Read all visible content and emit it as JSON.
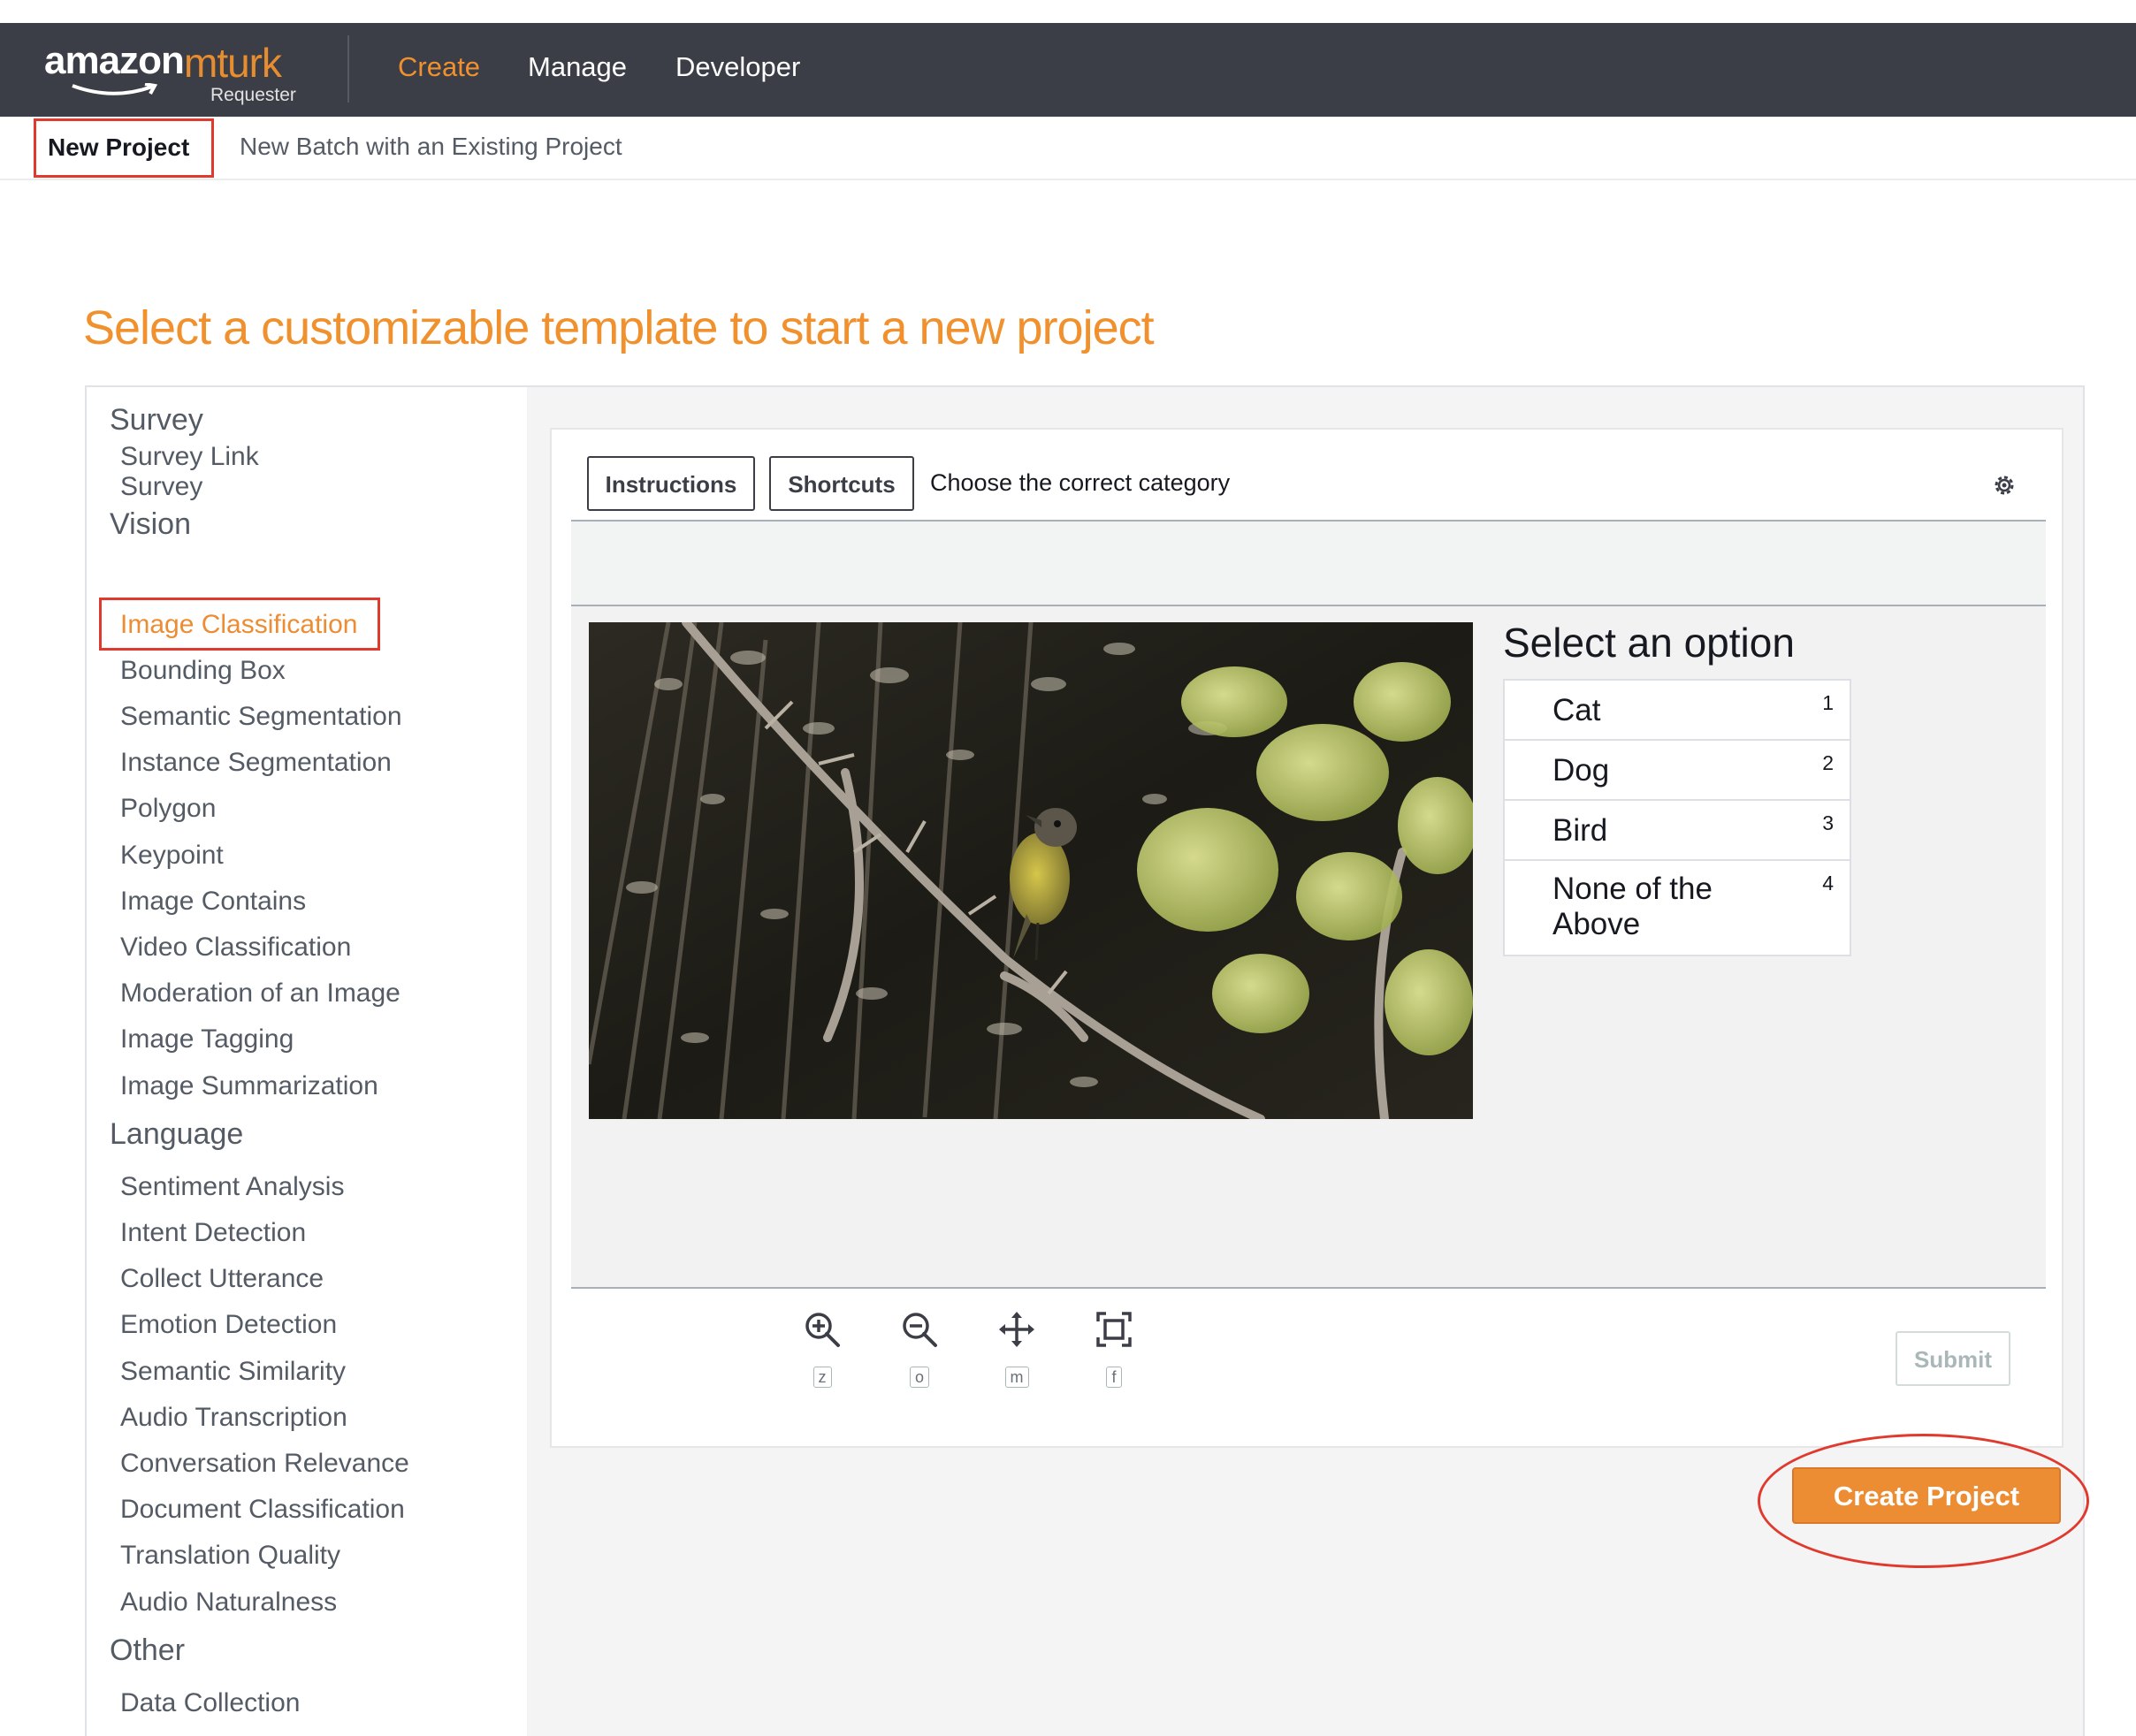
{
  "header": {
    "logo_amazon": "amazon",
    "logo_mturk": "mturk",
    "logo_requester": "Requester",
    "nav": [
      "Create",
      "Manage",
      "Developer"
    ],
    "bg_color": "#3b3e47",
    "accent_color": "#f0912e"
  },
  "subnav": {
    "new_project": "New Project",
    "new_batch": "New Batch with an Existing Project"
  },
  "page_title": "Select a customizable template to start a new project",
  "sidebar": {
    "categories": [
      "Survey",
      "Vision",
      "Language",
      "Other"
    ],
    "survey_items": [
      "Survey Link",
      "Survey"
    ],
    "vision_items": [
      "Image Classification",
      "Bounding Box",
      "Semantic Segmentation",
      "Instance Segmentation",
      "Polygon",
      "Keypoint",
      "Image Contains",
      "Video Classification",
      "Moderation of an Image",
      "Image Tagging",
      "Image Summarization"
    ],
    "language_items": [
      "Sentiment Analysis",
      "Intent Detection",
      "Collect Utterance",
      "Emotion Detection",
      "Semantic Similarity",
      "Audio Transcription",
      "Conversation Relevance",
      "Document Classification",
      "Translation Quality",
      "Audio Naturalness"
    ],
    "other_items": [
      "Data Collection"
    ],
    "selected": "Image Classification"
  },
  "preview": {
    "instructions_label": "Instructions",
    "shortcuts_label": "Shortcuts",
    "task_title": "Choose the correct category",
    "options_title": "Select an option",
    "options": [
      {
        "label": "Cat",
        "key": "1"
      },
      {
        "label": "Dog",
        "key": "2"
      },
      {
        "label": "Bird",
        "key": "3"
      },
      {
        "label": "None of the Above",
        "key": "4"
      }
    ],
    "tools": [
      {
        "icon": "zoom-in-icon",
        "key": "z"
      },
      {
        "icon": "zoom-out-icon",
        "key": "o"
      },
      {
        "icon": "move-icon",
        "key": "m"
      },
      {
        "icon": "fit-icon",
        "key": "f"
      }
    ],
    "submit_label": "Submit",
    "image_subject": "bird-on-branch-photo"
  },
  "create_project_label": "Create Project",
  "highlight_color": "#e03a2e"
}
